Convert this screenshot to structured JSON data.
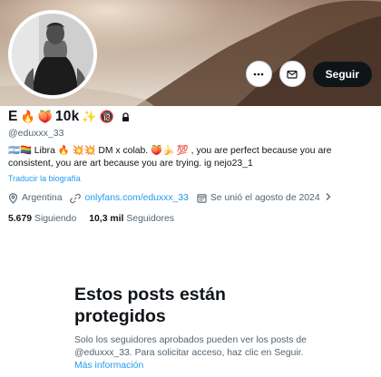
{
  "profile": {
    "display_name": "E",
    "name_suffix": "10k",
    "handle": "@eduxxx_33",
    "bio": "🇦🇷🏳️‍🌈 Libra 🔥 💥💥 DM x colab. 🍑🍌 💯 , you are perfect because you are consistent, you are art because you are trying. ig nejo23_1",
    "translate_label": "Traducir la biografía",
    "location": "Argentina",
    "website": "onlyfans.com/eduxxx_33",
    "joined": "Se unió el agosto de 2024",
    "following_count": "5.679",
    "following_label": "Siguiendo",
    "followers_count": "10,3 mil",
    "followers_label": "Seguidores"
  },
  "actions": {
    "more_icon": "more-horizontal-icon",
    "message_icon": "mail-icon",
    "follow_label": "Seguir"
  },
  "protected": {
    "title": "Estos posts están protegidos",
    "body": "Solo los seguidores aprobados pueden ver los posts de @eduxxx_33. Para solicitar acceso, haz clic en Seguir.",
    "more_link": "Más información"
  },
  "colors": {
    "accent": "#1d9bf0",
    "text": "#0f1419",
    "muted": "#536471",
    "button": "#0f1419"
  }
}
